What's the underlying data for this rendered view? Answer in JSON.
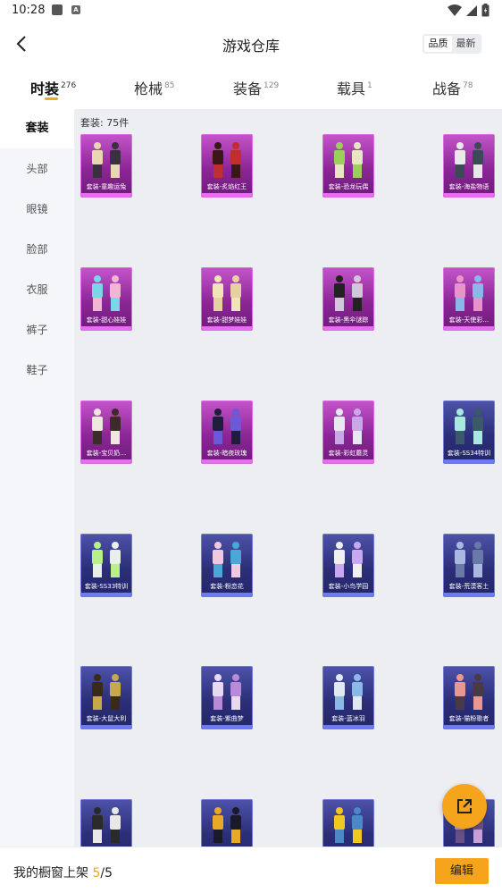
{
  "status_bar": {
    "time": "10:28",
    "badge": "A"
  },
  "header": {
    "title": "游戏仓库",
    "sort_options": [
      "品质",
      "最新"
    ]
  },
  "tabs": [
    {
      "label": "时装",
      "count": "276",
      "active": true
    },
    {
      "label": "枪械",
      "count": "85",
      "active": false
    },
    {
      "label": "装备",
      "count": "129",
      "active": false
    },
    {
      "label": "载具",
      "count": "1",
      "active": false
    },
    {
      "label": "战备",
      "count": "78",
      "active": false
    }
  ],
  "sidebar": {
    "items": [
      "套装",
      "头部",
      "眼镜",
      "脸部",
      "衣服",
      "裤子",
      "鞋子"
    ]
  },
  "main": {
    "count_label": "套装: 75件",
    "items": [
      {
        "name": "套装-童趣运兔",
        "tier": "purple"
      },
      {
        "name": "套装-炙焰红王",
        "tier": "purple"
      },
      {
        "name": "套装-恐龙玩偶",
        "tier": "purple"
      },
      {
        "name": "套装-海盐物语",
        "tier": "purple"
      },
      {
        "name": "套装-甜心娃娃",
        "tier": "purple"
      },
      {
        "name": "套装-甜梦娃娃",
        "tier": "purple"
      },
      {
        "name": "套装-黑伞谜踪",
        "tier": "purple"
      },
      {
        "name": "套装-天使彩…",
        "tier": "purple"
      },
      {
        "name": "套装-宝贝奶…",
        "tier": "purple"
      },
      {
        "name": "套装-暗夜玫瑰",
        "tier": "purple"
      },
      {
        "name": "套装-彩虹蘑灵",
        "tier": "purple"
      },
      {
        "name": "套装-SS34特训",
        "tier": "blue"
      },
      {
        "name": "套装-SS33特训",
        "tier": "blue"
      },
      {
        "name": "套装-粉恋花",
        "tier": "blue"
      },
      {
        "name": "套装-小鸟学园",
        "tier": "blue"
      },
      {
        "name": "套装-荒漠客土",
        "tier": "blue"
      },
      {
        "name": "套装-大鼠大利",
        "tier": "blue"
      },
      {
        "name": "套装-紫曲梦",
        "tier": "blue"
      },
      {
        "name": "套装-蓝冰羽",
        "tier": "blue"
      },
      {
        "name": "套装-猫粉歌者",
        "tier": "blue"
      },
      {
        "name": "",
        "tier": "blue"
      },
      {
        "name": "",
        "tier": "blue"
      },
      {
        "name": "",
        "tier": "blue"
      },
      {
        "name": "",
        "tier": "blue"
      }
    ]
  },
  "bottom_bar": {
    "label": "我的橱窗上架",
    "current": "5",
    "total": "/5",
    "edit_label": "编辑"
  },
  "colors": {
    "accent": "#f5a41c",
    "epic": "#8c2696",
    "rare": "#2c2f78"
  }
}
